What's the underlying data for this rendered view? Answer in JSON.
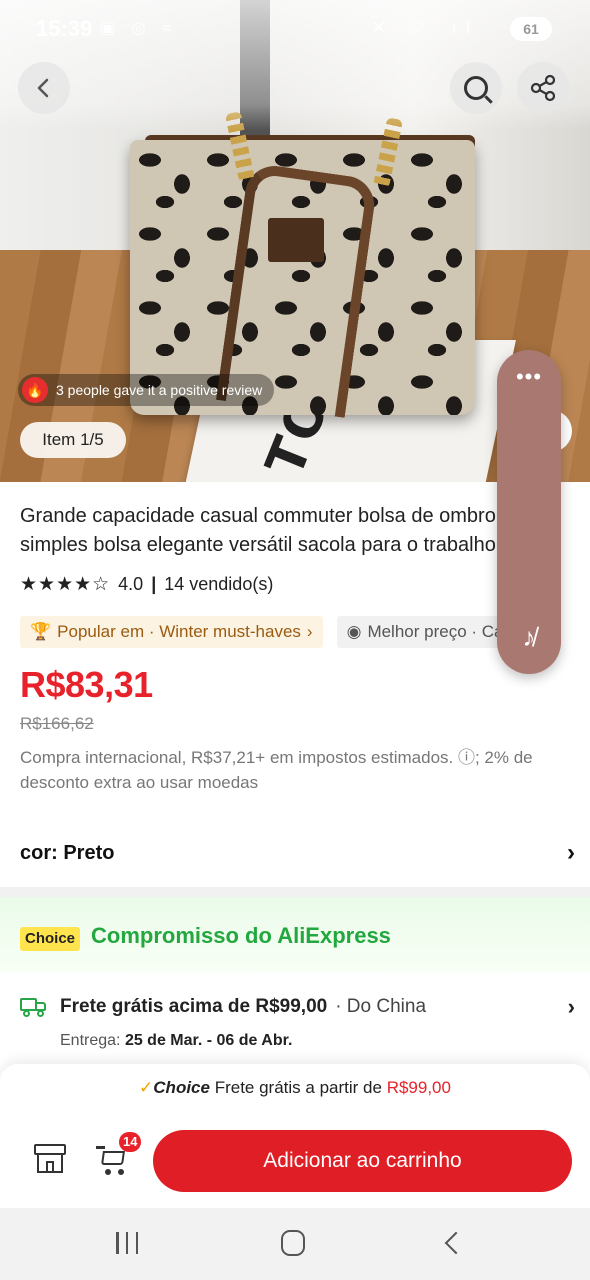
{
  "status_bar": {
    "time": "15:39",
    "battery": "61"
  },
  "gallery": {
    "review_chip": "3 people gave it a positive review",
    "item_counter": "Item 1/5",
    "book_text": "TOI"
  },
  "product": {
    "title": "Grande capacidade casual commuter bolsa de ombro moda simples bolsa elegante versátil sacola para o trabalho",
    "rating": "4.0",
    "sold": "14 vendido(s)",
    "tag_popular": "Popular em · Winter must-haves",
    "tag_best": "Melhor preço · Carteiras",
    "price": "R$83,31",
    "original_price": "R$166,62",
    "tax_note": "Compra internacional, R$37,21+ em impostos estimados. ⓘ; 2% de desconto extra ao usar moedas",
    "color_label": "cor: Preto"
  },
  "choice": {
    "badge": "Choice",
    "commitment_title": "Compromisso do AliExpress",
    "shipping_text": "Frete grátis acima de R$99,00",
    "shipping_origin": "· Do China",
    "delivery_label": "Entrega:",
    "delivery_dates": "25 de Mar. - 06 de Abr."
  },
  "bottom_bar": {
    "promo_check": "✓",
    "promo_choice": "Choice",
    "promo_text": "Frete grátis a partir de",
    "promo_amount": "R$99,00",
    "cart_count": "14",
    "add_to_cart_label": "Adicionar ao carrinho"
  },
  "icons": {
    "back": "chevron-left-icon",
    "search": "search-icon",
    "share": "share-icon",
    "fire": "fire-icon",
    "trophy": "trophy-icon",
    "medal": "medal-icon",
    "truck": "truck-icon",
    "store": "store-icon",
    "cart": "cart-icon",
    "more": "more-dots-icon",
    "mute": "music-off-icon"
  },
  "colors": {
    "price_red": "#e8222a",
    "button_red": "#e01e26",
    "choice_green": "#22a83e",
    "choice_yellow": "#ffe44d",
    "widget_brown": "#a97870"
  }
}
